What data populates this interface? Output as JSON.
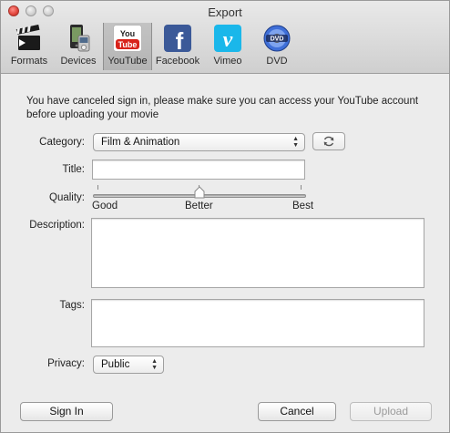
{
  "window": {
    "title": "Export"
  },
  "toolbar": {
    "items": [
      {
        "label": "Formats",
        "icon": "film-clapper-icon"
      },
      {
        "label": "Devices",
        "icon": "devices-icon"
      },
      {
        "label": "YouTube",
        "icon": "youtube-icon",
        "selected": true
      },
      {
        "label": "Facebook",
        "icon": "facebook-icon"
      },
      {
        "label": "Vimeo",
        "icon": "vimeo-icon"
      },
      {
        "label": "DVD",
        "icon": "dvd-icon"
      }
    ]
  },
  "notice": "You have canceled sign in, please make sure you can access your YouTube account before uploading your movie",
  "form": {
    "category_label": "Category:",
    "category_value": "Film & Animation",
    "title_label": "Title:",
    "title_value": "",
    "quality_label": "Quality:",
    "quality_min": "Good",
    "quality_mid": "Better",
    "quality_max": "Best",
    "quality_position": 0.5,
    "description_label": "Description:",
    "description_value": "",
    "tags_label": "Tags:",
    "tags_value": "",
    "privacy_label": "Privacy:",
    "privacy_value": "Public"
  },
  "buttons": {
    "sign_in": "Sign In",
    "cancel": "Cancel",
    "upload": "Upload"
  },
  "colors": {
    "youtube_red": "#d8231b",
    "facebook_blue": "#3b5998",
    "vimeo_blue": "#1ab7ea"
  }
}
